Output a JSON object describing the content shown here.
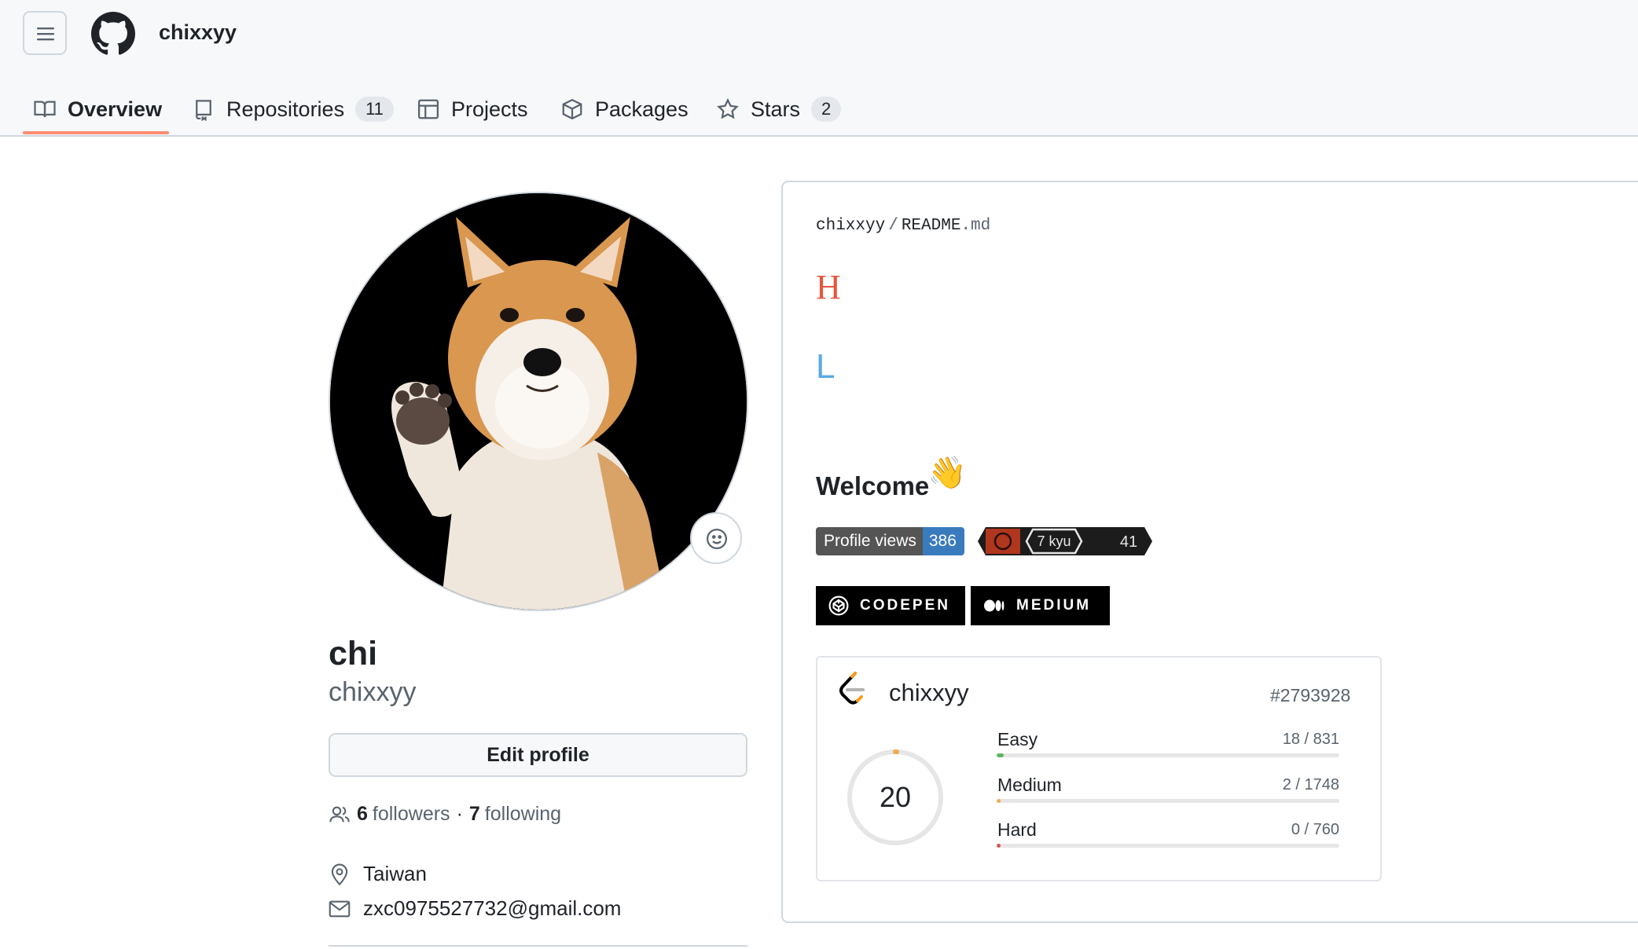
{
  "header": {
    "username": "chixxyy",
    "tabs": [
      {
        "label": "Overview",
        "count": null,
        "icon": "book-icon",
        "active": true
      },
      {
        "label": "Repositories",
        "count": "11",
        "icon": "repo-icon"
      },
      {
        "label": "Projects",
        "count": null,
        "icon": "table-icon"
      },
      {
        "label": "Packages",
        "count": null,
        "icon": "package-icon"
      },
      {
        "label": "Stars",
        "count": "2",
        "icon": "star-icon"
      }
    ]
  },
  "profile": {
    "name": "chi",
    "login": "chixxyy",
    "edit_label": "Edit profile",
    "followers_count": "6",
    "followers_label": "followers",
    "separator": "·",
    "following_count": "7",
    "following_label": "following",
    "location": "Taiwan",
    "email": "zxc0975527732@gmail.com"
  },
  "readme": {
    "owner": "chixxyy",
    "sep": "/",
    "file": "README",
    "ext": ".md",
    "heading_h": "H",
    "heading_l": "L",
    "welcome": "Welcome",
    "wave": "👋",
    "badge_views_label": "Profile views",
    "badge_views_value": "386",
    "badge_kyu": "7 kyu",
    "badge_score": "41",
    "social_codepen": "CODEPEN",
    "social_medium": "MEDIUM"
  },
  "leetcode": {
    "username": "chixxyy",
    "rank": "#2793928",
    "solved": "20",
    "rows": [
      {
        "label": "Easy",
        "value": "18 / 831",
        "solved": 18,
        "total": 831,
        "color": "#5cb85c"
      },
      {
        "label": "Medium",
        "value": "2 / 1748",
        "solved": 2,
        "total": 1748,
        "color": "#f0ad4e"
      },
      {
        "label": "Hard",
        "value": "0 / 760",
        "solved": 0,
        "total": 760,
        "color": "#d9534f"
      }
    ]
  },
  "colors": {
    "accent_underline": "#fd8c73",
    "heading_h": "#e4573d",
    "heading_l": "#5aa9e6",
    "views_blue": "#3a7bbd"
  }
}
